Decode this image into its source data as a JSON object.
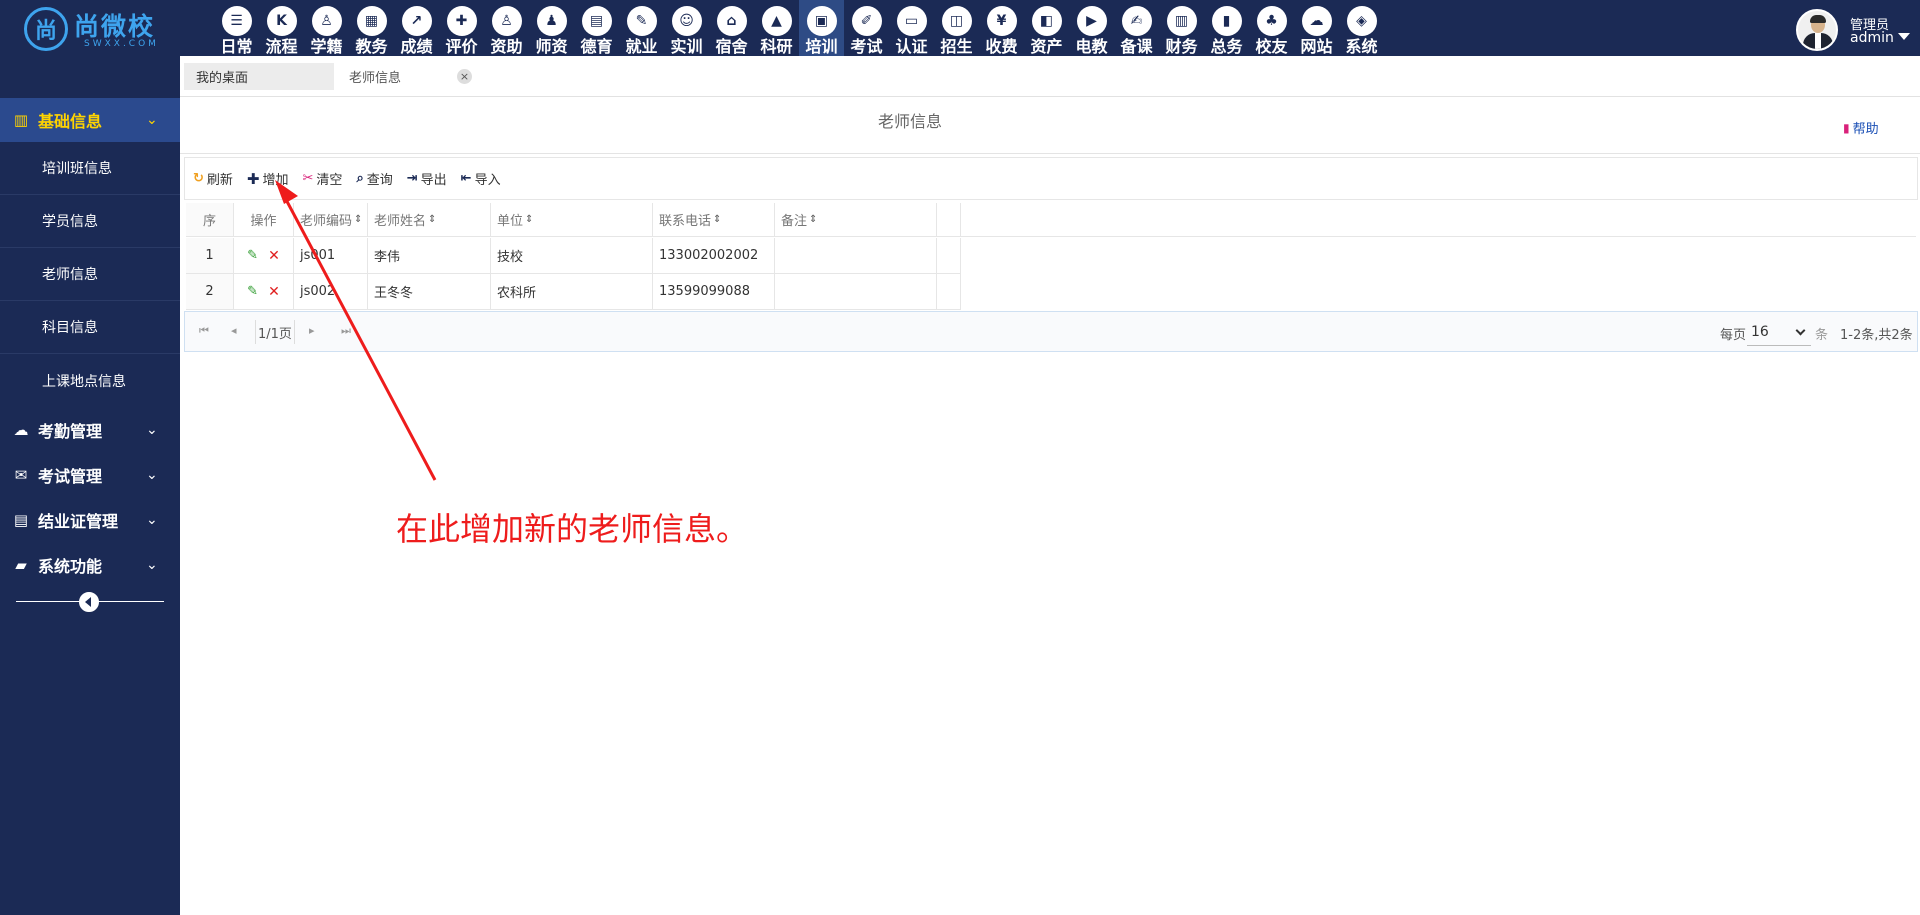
{
  "logo": {
    "mark": "尚",
    "name": "尚微校",
    "sub": "SWXX.COM"
  },
  "modules": [
    {
      "label": "日常",
      "icon": "☰",
      "active": false
    },
    {
      "label": "流程",
      "icon": "K",
      "active": false
    },
    {
      "label": "学籍",
      "icon": "♙",
      "active": false
    },
    {
      "label": "教务",
      "icon": "▦",
      "active": false
    },
    {
      "label": "成绩",
      "icon": "↗",
      "active": false
    },
    {
      "label": "评价",
      "icon": "✚",
      "active": false
    },
    {
      "label": "资助",
      "icon": "♙",
      "active": false
    },
    {
      "label": "师资",
      "icon": "♟",
      "active": false
    },
    {
      "label": "德育",
      "icon": "▤",
      "active": false
    },
    {
      "label": "就业",
      "icon": "✎",
      "active": false
    },
    {
      "label": "实训",
      "icon": "☺",
      "active": false
    },
    {
      "label": "宿舍",
      "icon": "⌂",
      "active": false
    },
    {
      "label": "科研",
      "icon": "▲",
      "active": false
    },
    {
      "label": "培训",
      "icon": "▣",
      "active": true
    },
    {
      "label": "考试",
      "icon": "✐",
      "active": false
    },
    {
      "label": "认证",
      "icon": "▭",
      "active": false
    },
    {
      "label": "招生",
      "icon": "◫",
      "active": false
    },
    {
      "label": "收费",
      "icon": "¥",
      "active": false
    },
    {
      "label": "资产",
      "icon": "◧",
      "active": false
    },
    {
      "label": "电教",
      "icon": "▶",
      "active": false
    },
    {
      "label": "备课",
      "icon": "✍",
      "active": false
    },
    {
      "label": "财务",
      "icon": "▥",
      "active": false
    },
    {
      "label": "总务",
      "icon": "▮",
      "active": false
    },
    {
      "label": "校友",
      "icon": "♣",
      "active": false
    },
    {
      "label": "网站",
      "icon": "☁",
      "active": false
    },
    {
      "label": "系统",
      "icon": "◈",
      "active": false
    }
  ],
  "user": {
    "role": "管理员",
    "name": "admin"
  },
  "sidebar": {
    "groups": [
      {
        "label": "基础信息",
        "icon": "▥",
        "active": true
      },
      {
        "label": "考勤管理",
        "icon": "☁",
        "active": false
      },
      {
        "label": "考试管理",
        "icon": "✉",
        "active": false
      },
      {
        "label": "结业证管理",
        "icon": "▤",
        "active": false
      },
      {
        "label": "系统功能",
        "icon": "▰",
        "active": false
      }
    ],
    "items": [
      {
        "label": "培训班信息"
      },
      {
        "label": "学员信息"
      },
      {
        "label": "老师信息"
      },
      {
        "label": "科目信息"
      },
      {
        "label": "上课地点信息"
      }
    ],
    "chevron": "⌄"
  },
  "tabs": {
    "desktop": "我的桌面",
    "teacher": "老师信息",
    "close": "×"
  },
  "page": {
    "title": "老师信息",
    "help": "帮助"
  },
  "toolbar": {
    "refresh": "刷新",
    "add": "增加",
    "clear": "清空",
    "query": "查询",
    "export": "导出",
    "import": "导入"
  },
  "table": {
    "headers": {
      "seq": "序",
      "op": "操作",
      "code": "老师编码",
      "name": "老师姓名",
      "unit": "单位",
      "phone": "联系电话",
      "note": "备注"
    },
    "rows": [
      {
        "seq": "1",
        "code": "js001",
        "name": "李伟",
        "unit": "技校",
        "phone": "133002002002",
        "note": ""
      },
      {
        "seq": "2",
        "code": "js002",
        "name": "王冬冬",
        "unit": "农科所",
        "phone": "13599099088",
        "note": ""
      }
    ]
  },
  "pager": {
    "page": "1/1页",
    "per_page_label": "每页",
    "per_page": "16",
    "unit": "条",
    "total": "1-2条,共2条"
  },
  "annotation": {
    "text": "在此增加新的老师信息。",
    "color": "#ee1c1c"
  },
  "colors": {
    "nav_bg": "#1b2a55",
    "active_group": "#2b4a8e",
    "active_text": "#ffd400",
    "accent_blue": "#3ea4ee"
  }
}
